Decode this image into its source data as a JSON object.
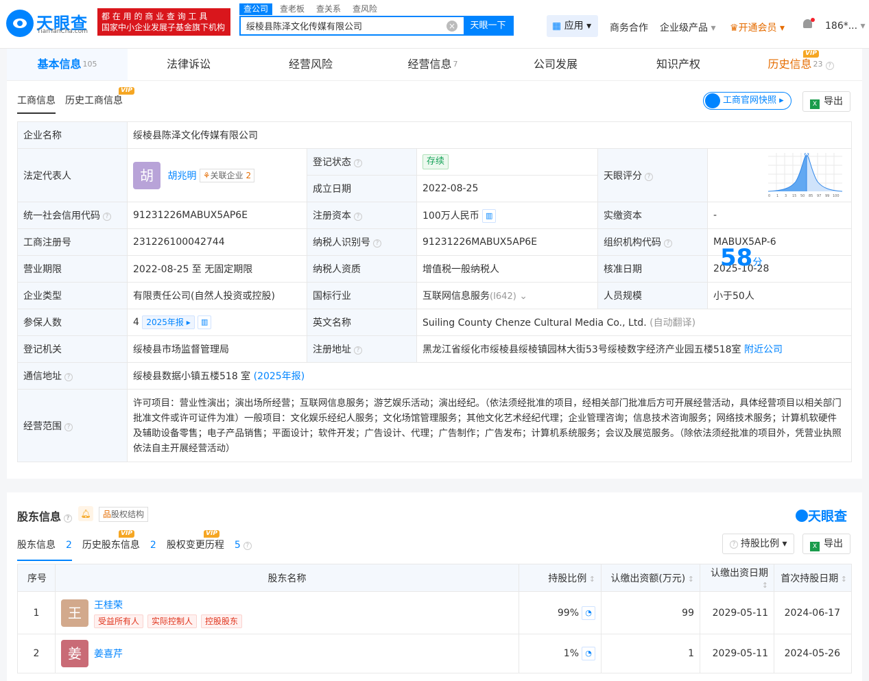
{
  "header": {
    "logo_text": "天眼查",
    "logo_sub": "TianYanCha.com",
    "slogan_line1": "都 在 用 的 商 业 查 询 工 具",
    "slogan_line2": "国家中小企业发展子基金旗下机构",
    "search_tabs": [
      "查公司",
      "查老板",
      "查关系",
      "查风险"
    ],
    "search_value": "绥棱县陈泽文化传媒有限公司",
    "search_button": "天眼一下",
    "app_label": "应用",
    "nav": {
      "biz": "商务合作",
      "enterprise": "企业级产品",
      "vip": "开通会员",
      "user": "186*..."
    }
  },
  "main_tabs": [
    {
      "label": "基本信息",
      "count": "105"
    },
    {
      "label": "法律诉讼",
      "count": ""
    },
    {
      "label": "经营风险",
      "count": ""
    },
    {
      "label": "经营信息",
      "count": "7"
    },
    {
      "label": "公司发展",
      "count": ""
    },
    {
      "label": "知识产权",
      "count": ""
    },
    {
      "label": "历史信息",
      "count": "23"
    }
  ],
  "vip_text": "VIP",
  "info": {
    "subtab_active": "工商信息",
    "subtab_history": "历史工商信息",
    "snapshot_button": "工商官网快照",
    "export_button": "导出",
    "rows": {
      "company_name_label": "企业名称",
      "company_name": "绥棱县陈泽文化传媒有限公司",
      "legal_rep_label": "法定代表人",
      "legal_rep_avatar": "胡",
      "legal_rep": "胡兆明",
      "related_label": "关联企业",
      "related_count": "2",
      "reg_status_label": "登记状态",
      "reg_status": "存续",
      "founded_label": "成立日期",
      "founded": "2022-08-25",
      "score_label": "天眼评分",
      "score": "58",
      "score_unit": "分",
      "score_axis": [
        "0",
        "1",
        "3",
        "15",
        "50",
        "85",
        "97",
        "99",
        "100"
      ],
      "credit_code_label": "统一社会信用代码",
      "credit_code": "91231226MABUX5AP6E",
      "reg_capital_label": "注册资本",
      "reg_capital": "100万人民币",
      "paid_capital_label": "实缴资本",
      "paid_capital": "-",
      "biz_reg_no_label": "工商注册号",
      "biz_reg_no": "231226100042744",
      "taxpayer_id_label": "纳税人识别号",
      "taxpayer_id": "91231226MABUX5AP6E",
      "org_code_label": "组织机构代码",
      "org_code": "MABUX5AP-6",
      "term_label": "营业期限",
      "term": "2022-08-25 至 无固定期限",
      "taxpayer_type_label": "纳税人资质",
      "taxpayer_type": "增值税一般纳税人",
      "approval_label": "核准日期",
      "approval": "2025-10-28",
      "ent_type_label": "企业类型",
      "ent_type": "有限责任公司(自然人投资或控股)",
      "industry_label": "国标行业",
      "industry": "互联网信息服务",
      "industry_code": "(I642)",
      "staff_label": "人员规模",
      "staff": "小于50人",
      "insured_label": "参保人数",
      "insured": "4",
      "insured_year": "2025年报",
      "en_name_label": "英文名称",
      "en_name": "Suiling County Chenze Cultural Media Co., Ltd.",
      "en_name_note": "(自动翻译)",
      "authority_label": "登记机关",
      "authority": "绥棱县市场监督管理局",
      "address_label": "注册地址",
      "address": "黑龙江省绥化市绥棱县绥棱镇园林大街53号绥棱数字经济产业园五楼518室",
      "nearby": "附近公司",
      "mail_label": "通信地址",
      "mail": "绥棱县数据小镇五楼518 室",
      "mail_year": "(2025年报)",
      "scope_label": "经营范围",
      "scope": "许可项目：营业性演出；演出场所经营；互联网信息服务；游艺娱乐活动；演出经纪。（依法须经批准的项目，经相关部门批准后方可开展经营活动，具体经营项目以相关部门批准文件或许可证件为准）一般项目：文化娱乐经纪人服务；文化场馆管理服务；其他文化艺术经纪代理；企业管理咨询；信息技术咨询服务；网络技术服务；计算机软硬件及辅助设备零售；电子产品销售；平面设计；软件开发；广告设计、代理；广告制作；广告发布；计算机系统服务；会议及展览服务。（除依法须经批准的项目外，凭营业执照依法自主开展经营活动）"
    }
  },
  "shareholders": {
    "title": "股东信息",
    "struct_button": "股权结构",
    "logo": "天眼查",
    "subtabs": [
      {
        "label": "股东信息",
        "count": "2"
      },
      {
        "label": "历史股东信息",
        "count": "2"
      },
      {
        "label": "股权变更历程",
        "count": "5"
      }
    ],
    "ratio_button": "持股比例",
    "export_button": "导出",
    "columns": [
      "序号",
      "股东名称",
      "持股比例",
      "认缴出资额(万元)",
      "认缴出资日期",
      "首次持股日期"
    ],
    "rows": [
      {
        "no": "1",
        "avatar": "王",
        "name": "王桂荣",
        "tags": [
          "受益所有人",
          "实际控制人",
          "控股股东"
        ],
        "ratio": "99%",
        "amount": "99",
        "date": "2029-05-11",
        "first": "2024-06-17"
      },
      {
        "no": "2",
        "avatar": "姜",
        "name": "姜喜芹",
        "tags": [],
        "ratio": "1%",
        "amount": "1",
        "date": "2029-05-11",
        "first": "2024-05-26"
      }
    ]
  },
  "colors": {
    "brand": "#0084ff",
    "vip": "#f5a623",
    "danger": "#d9161c",
    "active_green": "#18a35a"
  }
}
